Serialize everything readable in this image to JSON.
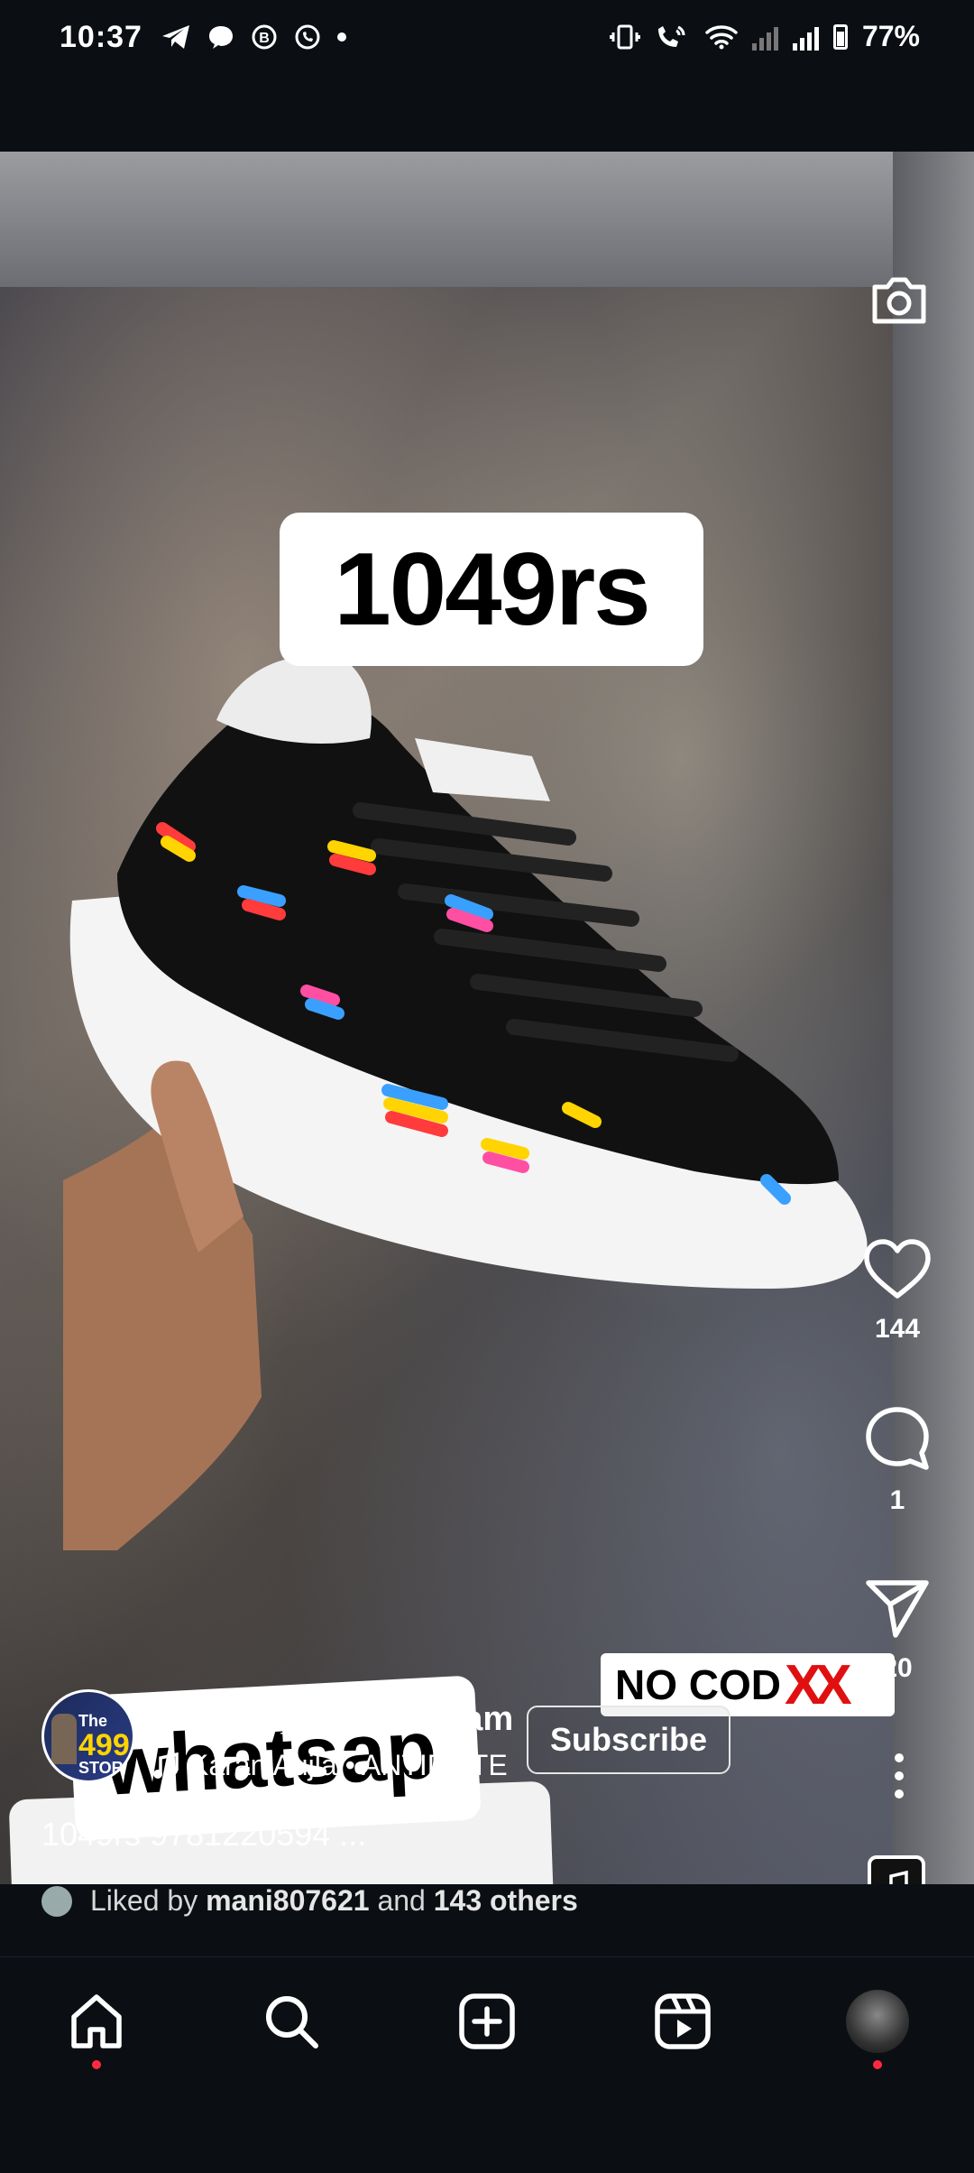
{
  "status_bar": {
    "time": "10:37",
    "battery": "77%",
    "left_icons": [
      "telegram-icon",
      "chat-icon",
      "b-icon",
      "whatsapp-icon",
      "dot-icon"
    ],
    "right_icons": [
      "vibrate-icon",
      "volte-call-icon",
      "wifi-icon",
      "signal-icon",
      "signal-icon",
      "battery-icon"
    ]
  },
  "video": {
    "price_sticker": "1049rs",
    "whatsapp_sticker": "whatsap",
    "nocod_sticker": "NO COD",
    "nocod_marks": "XX"
  },
  "actions": {
    "likes_count": "144",
    "comments_count": "1",
    "shares_count": "20"
  },
  "author": {
    "avatar_top": "The",
    "avatar_number": "499",
    "avatar_bottom": "STOR",
    "username": "the_499_store_sunam",
    "subscribe_label": "Subscribe",
    "audio": "Karan Aujla • ANTIDOTE"
  },
  "caption": "1049rs 9781220594 ...",
  "liked_by": {
    "prefix": "Liked by ",
    "user": "mani807621",
    "middle": " and ",
    "others": "143 others"
  },
  "colors": {
    "background": "#0b0f14",
    "notification_dot": "#ff2a3d",
    "nocod_x": "#e01010"
  }
}
